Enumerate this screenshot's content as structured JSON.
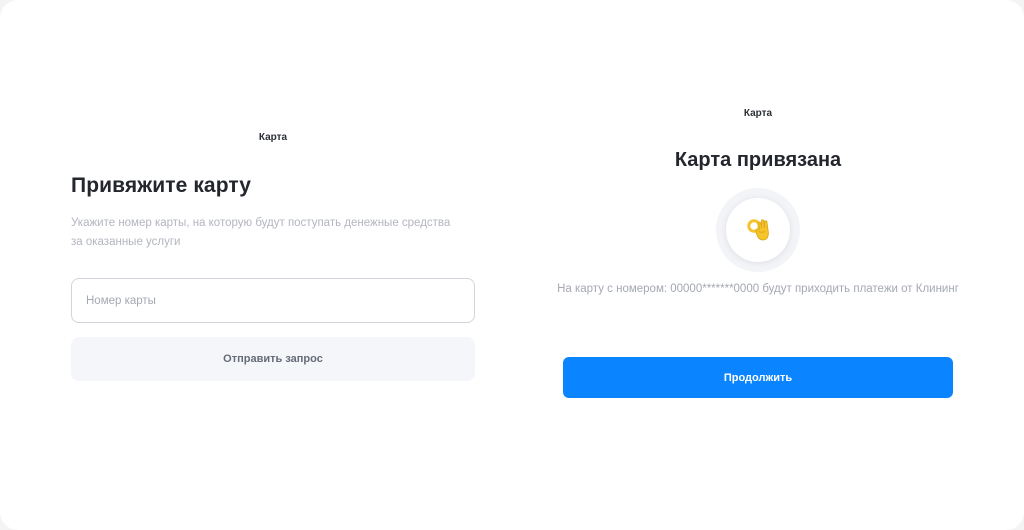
{
  "link_card": {
    "header": "Карта",
    "title": "Привяжите карту",
    "description": "Укажите номер карты, на которую будут поступать денежные средства за оказанные услуги",
    "card_number_input": {
      "value": "",
      "placeholder": "Номер карты"
    },
    "submit_label": "Отправить запрос"
  },
  "card_linked": {
    "header": "Карта",
    "title": "Карта привязана",
    "icon": "ok-hand-icon",
    "message": "На карту с номером: 00000*******0000 будут приходить платежи от Клининг",
    "continue_label": "Продолжить"
  },
  "colors": {
    "accent": "#0a84ff",
    "secondary_button_bg": "#f4f6f9",
    "muted_text": "#a4a8b3",
    "title_text": "#23262d",
    "emoji_yellow": "#f5c32c"
  }
}
